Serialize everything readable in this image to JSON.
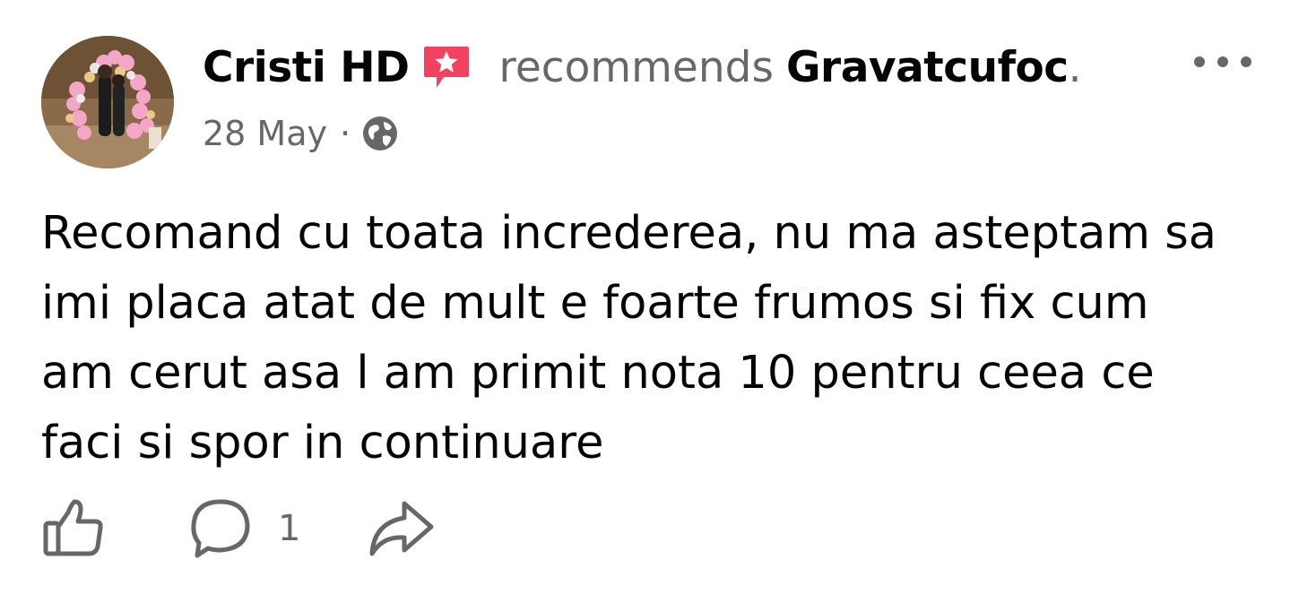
{
  "post": {
    "author": "Cristi HD",
    "action_word": "recommends",
    "page_name": "Gravatcufoc",
    "page_suffix": ".",
    "date": "28 May",
    "separator": "·",
    "privacy_icon": "globe-icon",
    "recommend_icon": "recommend-star-icon",
    "body_lines": [
      "Recomand cu toata increderea, nu ma asteptam sa",
      "imi placa atat de mult e foarte frumos si fix cum",
      "am cerut asa l am primit nota 10 pentru ceea ce",
      "faci si spor in continuare"
    ],
    "comment_count": "1"
  },
  "actions": {
    "like_icon": "thumbs-up-icon",
    "comment_icon": "comment-bubble-icon",
    "share_icon": "share-arrow-icon",
    "more_icon": "more-options-icon"
  },
  "colors": {
    "text": "#050505",
    "secondary_text": "#65676b",
    "recommend_badge": "#f3425f",
    "background": "#ffffff"
  }
}
